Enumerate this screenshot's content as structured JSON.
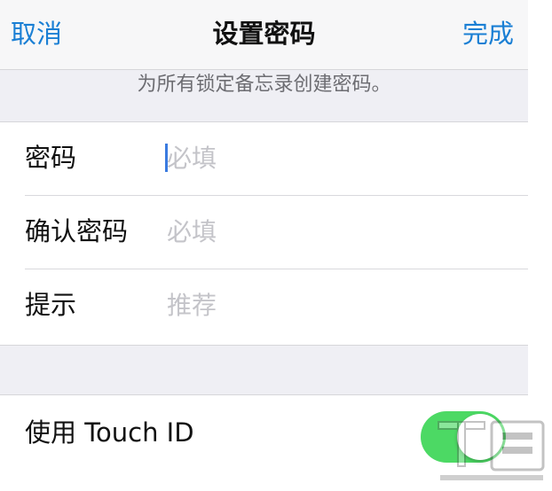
{
  "navbar": {
    "cancel_label": "取消",
    "title": "设置密码",
    "done_label": "完成"
  },
  "hint": "为所有锁定备忘录创建密码。",
  "fields": [
    {
      "label": "密码",
      "placeholder": "必填",
      "focused": true
    },
    {
      "label": "确认密码",
      "placeholder": "必填",
      "focused": false
    },
    {
      "label": "提示",
      "placeholder": "推荐",
      "focused": false
    }
  ],
  "touch_id": {
    "label": "使用 Touch ID",
    "enabled": true
  },
  "colors": {
    "accent": "#1a7fd4",
    "switch_on": "#4cd964",
    "background": "#efeff4",
    "placeholder": "#c4c4c9"
  },
  "icons": {
    "watermark": "site-watermark-logo"
  }
}
